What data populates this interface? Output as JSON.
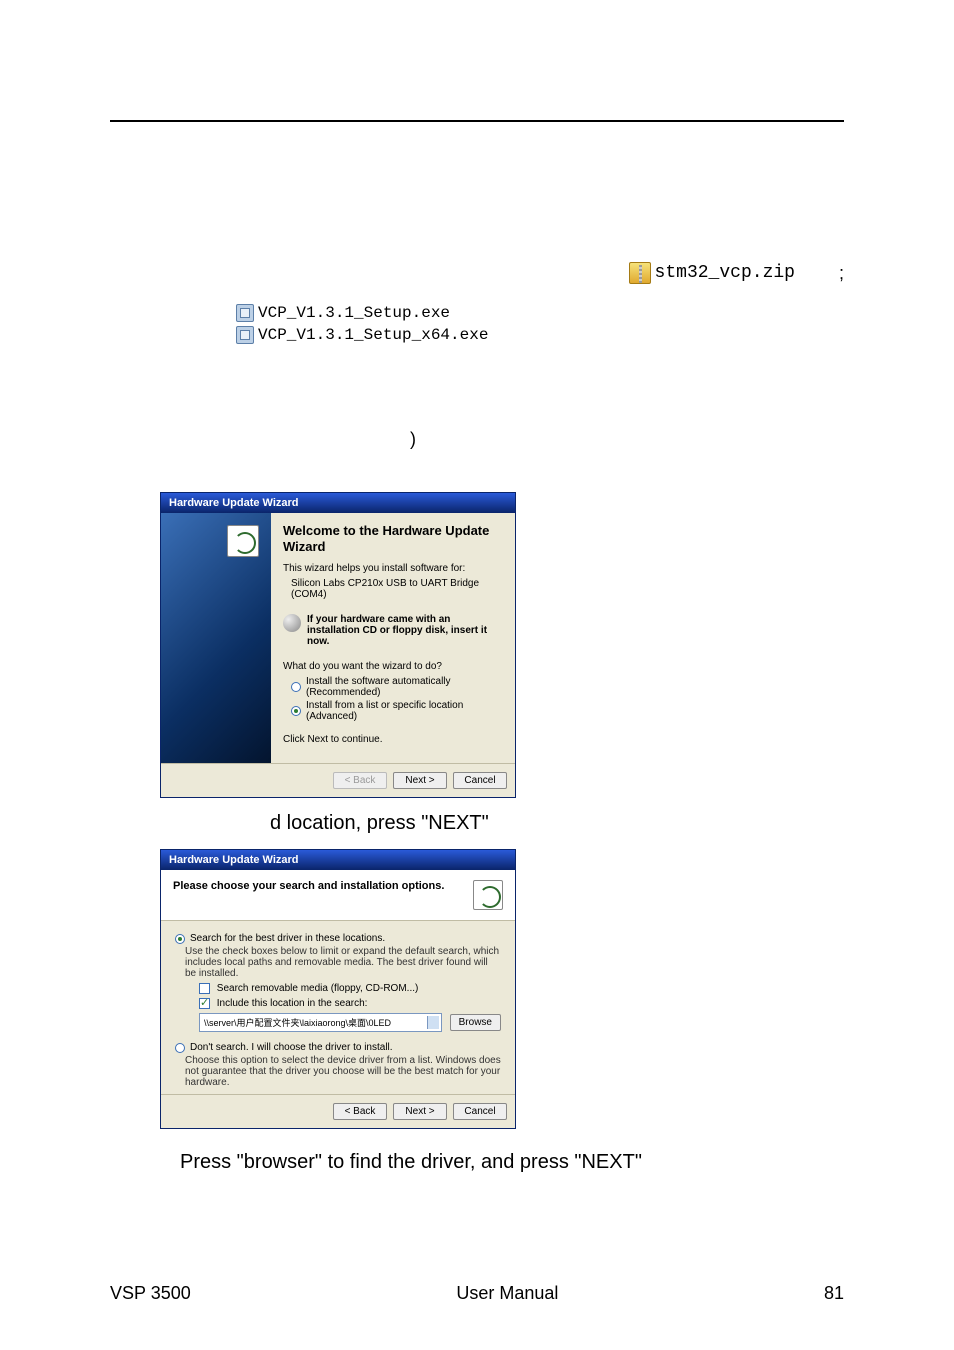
{
  "line1": {
    "zip_label": "stm32_vcp.zip",
    "tail": ";"
  },
  "exe": {
    "file1": "VCP_V1.3.1_Setup.exe",
    "file2": "VCP_V1.3.1_Setup_x64.exe"
  },
  "paren": ")",
  "wizard1": {
    "title": "Hardware Update Wizard",
    "heading": "Welcome to the Hardware Update Wizard",
    "intro": "This wizard helps you install software for:",
    "device": "Silicon Labs CP210x USB to UART Bridge (COM4)",
    "cd_hint": "If your hardware came with an installation CD or floppy disk, insert it now.",
    "question": "What do you want the wizard to do?",
    "opt_auto": "Install the software automatically (Recommended)",
    "opt_list": "Install from a list or specific location (Advanced)",
    "continue": "Click Next to continue.",
    "back": "< Back",
    "next": "Next >",
    "cancel": "Cancel"
  },
  "between": "d location, press \"NEXT\"",
  "wizard2": {
    "title": "Hardware Update Wizard",
    "head": "Please choose your search and installation options.",
    "opt_search": "Search for the best driver in these locations.",
    "search_desc": "Use the check boxes below to limit or expand the default search, which includes local paths and removable media. The best driver found will be installed.",
    "cb_removable": "Search removable media (floppy, CD-ROM...)",
    "cb_include": "Include this location in the search:",
    "path": "\\\\server\\用户配置文件夹\\laixiaorong\\桌面\\0LED",
    "browse": "Browse",
    "opt_dont": "Don't search. I will choose the driver to install.",
    "dont_desc": "Choose this option to select the device driver from a list. Windows does not guarantee that the driver you choose will be the best match for your hardware.",
    "back": "< Back",
    "next": "Next >",
    "cancel": "Cancel"
  },
  "after": "Press \"browser\" to find the driver, and press \"NEXT\"",
  "footer": {
    "left": "VSP 3500",
    "center": "User Manual",
    "right": "81"
  }
}
